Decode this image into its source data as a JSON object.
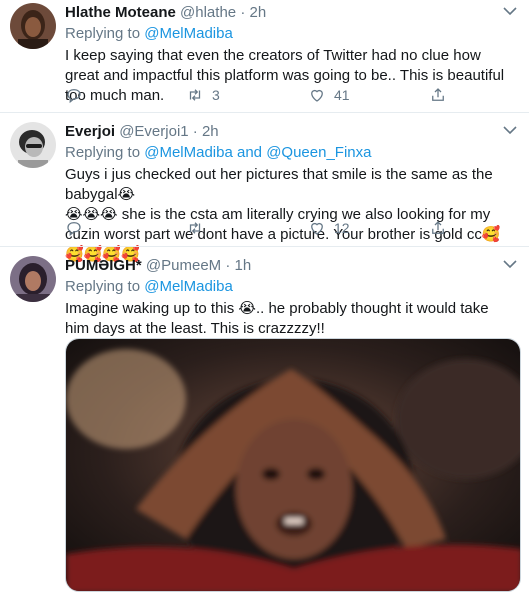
{
  "tweets": [
    {
      "name": "Hlathe Moteane",
      "handle": "@hlathe",
      "time": "2h",
      "replying_prefix": "Replying to",
      "replying_to": [
        "@MelMadiba"
      ],
      "text": "I keep saying that even the creators of Twitter had no clue how great and impactful this platform was going to be.. This is beautiful too much man.",
      "retweets": "3",
      "likes": "41"
    },
    {
      "name": "Everjoi",
      "handle": "@Everjoi1",
      "time": "2h",
      "replying_prefix": "Replying to",
      "replying_to": [
        "@MelMadiba",
        "@Queen_Finxa"
      ],
      "replying_joiner": "and",
      "text": "Guys i jus checked out her pictures that smile is the same as the babygal😭\n😭😭😭 she is the csta am literally crying we also looking for my cuzin worst part we dont have a picture. Your brother is gold cc🥰🥰🥰🥰🥰",
      "retweets": "",
      "likes": "12"
    },
    {
      "name": "PUMƏIGH*",
      "handle": "@PumeeM",
      "time": "1h",
      "replying_prefix": "Replying to",
      "replying_to": [
        "@MelMadiba"
      ],
      "text": "Imagine waking up to this 😭.. he probably thought it would take him days at the least. This is crazzzzy!!",
      "media_alt": "GIF of a woman with hands over her head, reacting in shock"
    }
  ],
  "icons": {
    "reply": "reply-icon",
    "retweet": "retweet-icon",
    "like": "heart-icon",
    "share": "share-icon",
    "more": "chevron-down-icon"
  },
  "colors": {
    "link": "#1b95e0",
    "muted": "#657786",
    "divider": "#e6ecf0"
  }
}
